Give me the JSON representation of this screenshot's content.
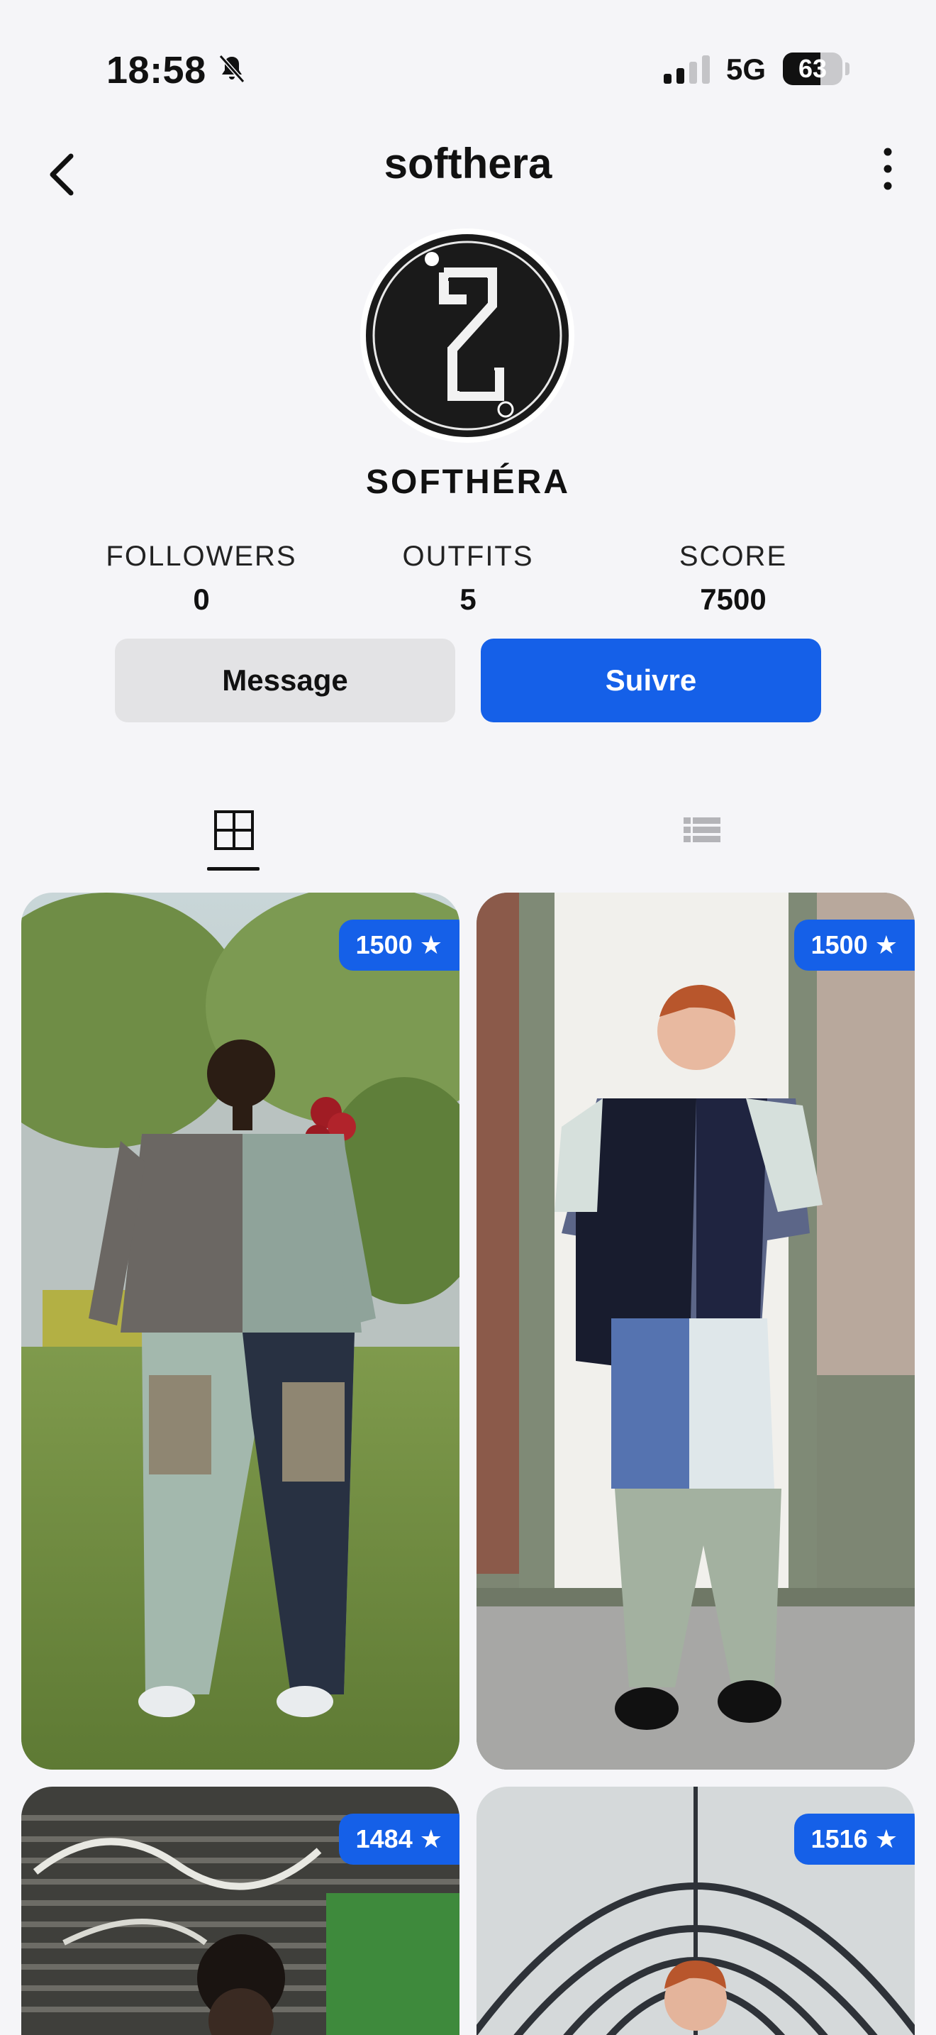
{
  "status": {
    "time": "18:58",
    "network": "5G",
    "battery": "63",
    "battery_level": 0.63
  },
  "header": {
    "title": "softhera"
  },
  "profile": {
    "name": "SOFTHÉRA",
    "stats": [
      {
        "label": "FOLLOWERS",
        "value": "0"
      },
      {
        "label": "OUTFITS",
        "value": "5"
      },
      {
        "label": "SCORE",
        "value": "7500"
      }
    ],
    "message_label": "Message",
    "follow_label": "Suivre"
  },
  "tabs": [
    {
      "name": "grid",
      "icon": "grid-icon",
      "active": true
    },
    {
      "name": "list",
      "icon": "list-icon",
      "active": false
    }
  ],
  "posts": [
    {
      "score": "1500 ★"
    },
    {
      "score": "1500 ★"
    },
    {
      "score": "1484 ★"
    },
    {
      "score": "1516 ★"
    }
  ],
  "colors": {
    "accent": "#1560e8",
    "background": "#f5f5f8",
    "secondary_button": "#e3e3e5"
  }
}
